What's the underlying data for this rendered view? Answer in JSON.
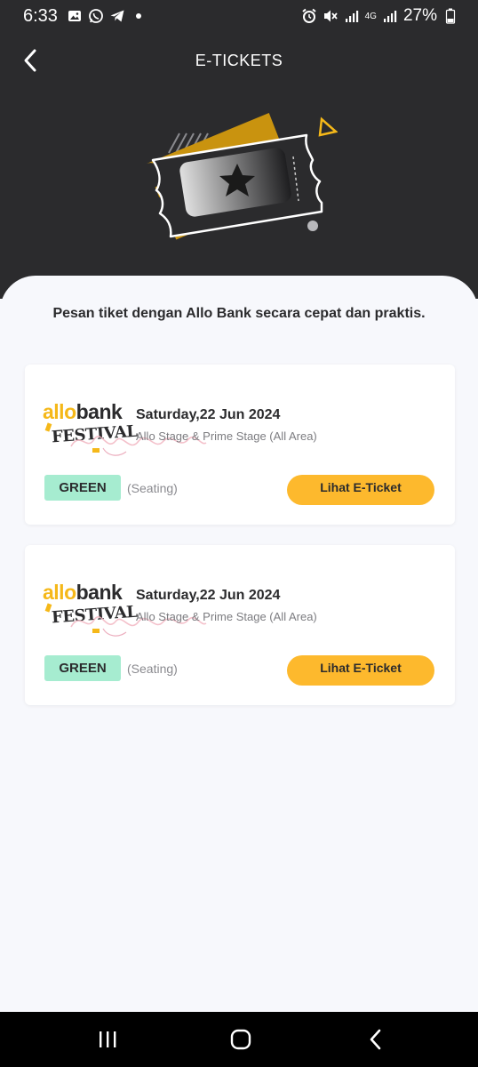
{
  "status_bar": {
    "time": "6:33",
    "battery": "27%",
    "network": "4G",
    "icons": [
      "gallery-icon",
      "whatsapp-icon",
      "telegram-icon",
      "dot-icon",
      "alarm-icon",
      "mute-icon",
      "signal-icon",
      "signal-icon",
      "battery-icon"
    ]
  },
  "header": {
    "title": "E-TICKETS",
    "back_icon": "chevron-left-icon",
    "illustration": "ticket-star-illustration"
  },
  "content": {
    "tagline": "Pesan tiket dengan Allo Bank secara cepat dan praktis."
  },
  "tickets": [
    {
      "logo_allo": "allo",
      "logo_bank": "bank",
      "logo_festival": "FESTIVAL",
      "date": "Saturday,22 Jun 2024",
      "venue": "Allo Stage & Prime Stage (All Area)",
      "category": "GREEN",
      "seating": "(Seating)",
      "button": "Lihat E-Ticket"
    },
    {
      "logo_allo": "allo",
      "logo_bank": "bank",
      "logo_festival": "FESTIVAL",
      "date": "Saturday,22 Jun 2024",
      "venue": "Allo Stage & Prime Stage (All Area)",
      "category": "GREEN",
      "seating": "(Seating)",
      "button": "Lihat E-Ticket"
    }
  ],
  "colors": {
    "header_bg": "#2b2b2d",
    "accent_yellow": "#fdb92d",
    "badge_green": "#a6ecd0",
    "page_bg": "#f7f8fc"
  },
  "nav_bar": {
    "icons": [
      "recent-apps-icon",
      "home-icon",
      "back-icon"
    ]
  }
}
